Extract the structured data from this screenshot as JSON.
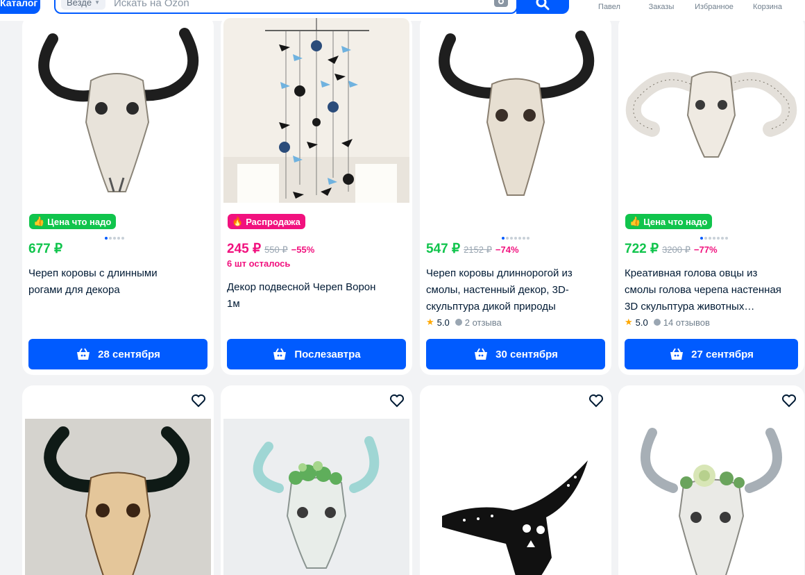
{
  "header": {
    "catalog_label": "Каталог",
    "scope_label": "Везде",
    "search_placeholder": "Искать на Ozon",
    "nav": [
      {
        "label": "Павел",
        "icon": "user-icon"
      },
      {
        "label": "Заказы",
        "icon": "orders-icon"
      },
      {
        "label": "Избранное",
        "icon": "heart-icon"
      },
      {
        "label": "Корзина",
        "icon": "cart-icon"
      }
    ]
  },
  "colors": {
    "accent": "#005bff",
    "price_green": "#10c44c",
    "sale_pink": "#f1117e"
  },
  "products": [
    {
      "badge": "Цена что надо",
      "badge_type": "green",
      "price": "677 ₽",
      "old_price": "",
      "discount": "",
      "stock": "",
      "title_lines": [
        "Череп коровы с длинными",
        "рогами для декора"
      ],
      "rating": "",
      "reviews": "",
      "delivery": "28 сентября"
    },
    {
      "badge": "Распродажа",
      "badge_type": "pink",
      "price": "245 ₽",
      "old_price": "550 ₽",
      "discount": "−55%",
      "stock": "6 шт осталось",
      "title_lines": [
        "Декор подвесной Череп Ворон",
        "1м"
      ],
      "rating": "",
      "reviews": "",
      "delivery": "Послезавтра"
    },
    {
      "badge": "",
      "badge_type": "",
      "price": "547 ₽",
      "old_price": "2152 ₽",
      "discount": "−74%",
      "stock": "",
      "title_lines": [
        "Череп коровы длиннорогой из",
        "смолы, настенный декор, 3D-",
        "скульптура дикой природы"
      ],
      "rating": "5.0",
      "reviews": "2 отзыва",
      "delivery": "30 сентября"
    },
    {
      "badge": "Цена что надо",
      "badge_type": "green",
      "price": "722 ₽",
      "old_price": "3200 ₽",
      "discount": "−77%",
      "stock": "",
      "title_lines": [
        "Креативная голова овцы из",
        "смолы голова черепа настенная",
        "3D скульптура животных…"
      ],
      "rating": "5.0",
      "reviews": "14 отзывов",
      "delivery": "27 сентября"
    }
  ]
}
